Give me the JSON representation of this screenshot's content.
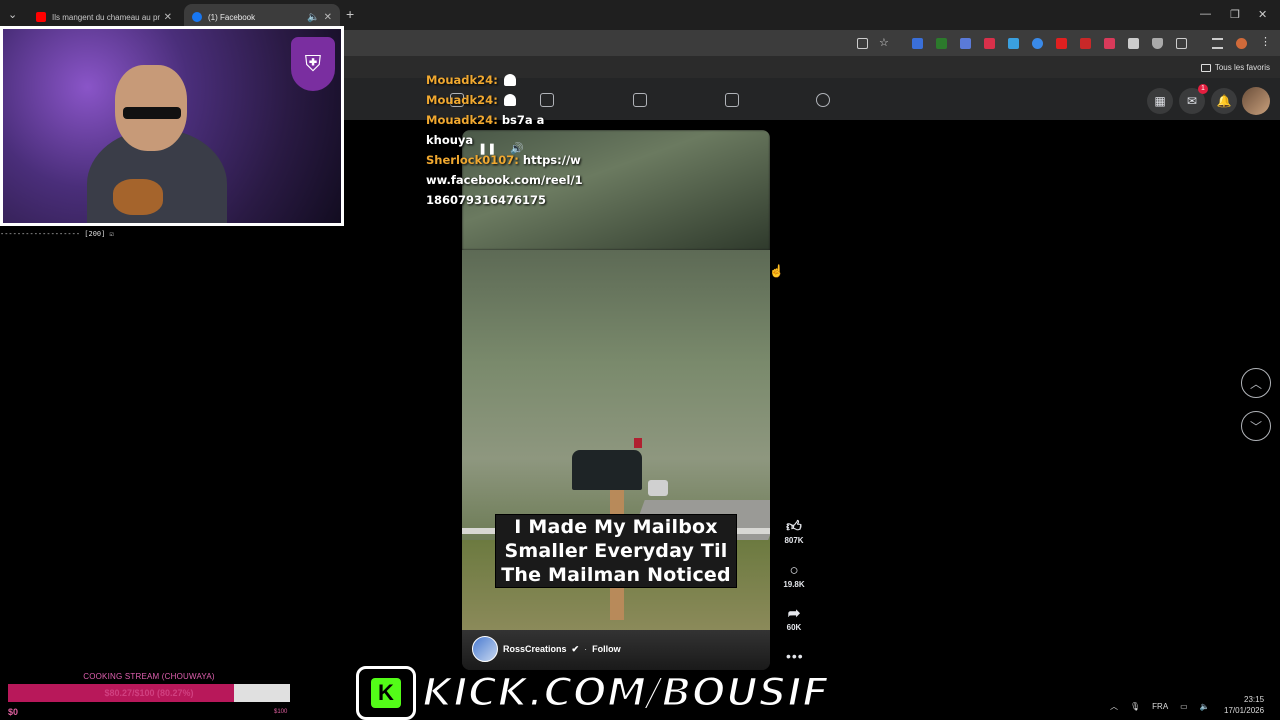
{
  "browser": {
    "tabs": [
      {
        "title": "Ils mangent du chameau au pr...",
        "favicon_color": "#ff0000",
        "active": false
      },
      {
        "title": "(1) Facebook",
        "favicon_color": "#1877f2",
        "active": true
      }
    ],
    "bookmarks_label": "Tous les favoris"
  },
  "facebook": {
    "notification_count": "1"
  },
  "reel": {
    "caption_lines": [
      "I Made My Mailbox",
      "Smaller Everyday Til",
      "The Mailman Noticed"
    ],
    "author": "RossCreations",
    "follow_label": "Follow",
    "likes": "807K",
    "comments": "19.8K",
    "shares": "60K"
  },
  "stream": {
    "chat": [
      {
        "user": "Mouadk24",
        "message": ""
      },
      {
        "user": "Mouadk24",
        "message": ""
      },
      {
        "user": "Mouadk24",
        "message": "bs7a a khouya"
      },
      {
        "user": "Sherlock0107",
        "message": "https://www.facebook.com/reel/1186079316476175"
      }
    ],
    "webcam_tick": "------------------- [200] ☑",
    "goal_title": "COOKING STREAM (CHOUWAYA)",
    "goal_text": "$80.27/$100 (80.27%)",
    "goal_progress": 0.8027,
    "goal_min": "$0",
    "goal_max": "$100",
    "kick_text": "KICK.COM/BOUSIF"
  },
  "taskbar": {
    "language": "FRA",
    "time": "23:15",
    "date": "17/01/2026"
  }
}
